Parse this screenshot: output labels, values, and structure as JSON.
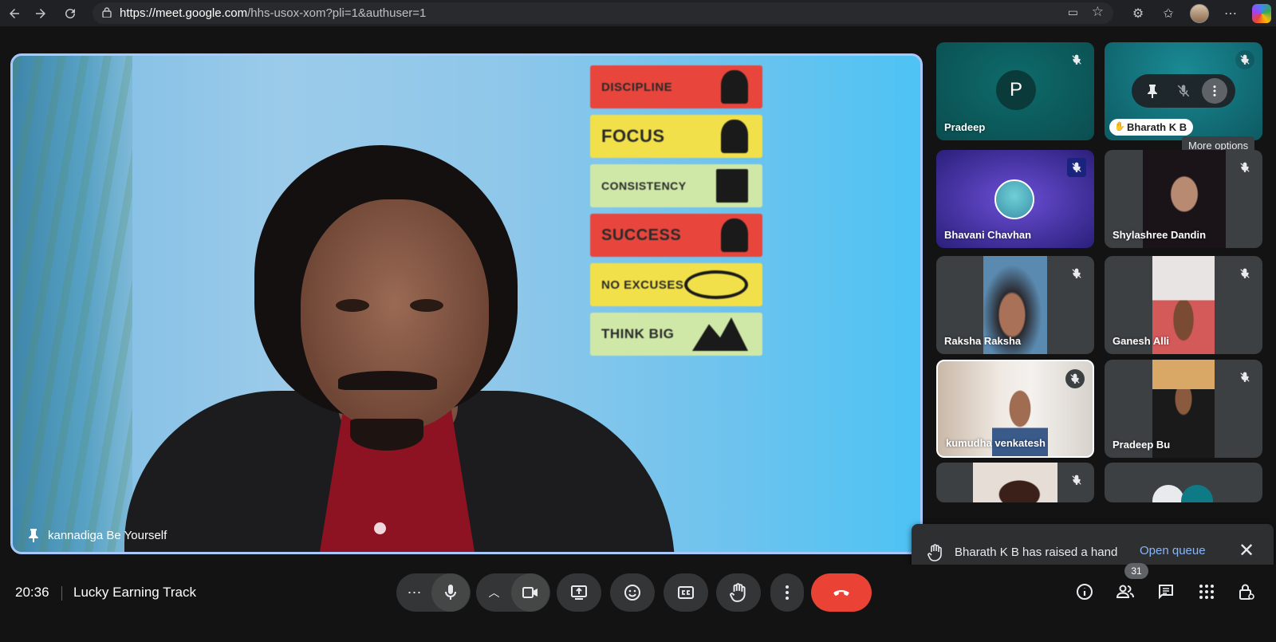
{
  "browser": {
    "url_host": "https://meet.google.com",
    "url_path": "/hhs-usox-xom?pli=1&authuser=1"
  },
  "main_video": {
    "participant_name": "kannadiga Be Yourself",
    "posters": [
      "DISCIPLINE",
      "FOCUS",
      "CONSISTENCY",
      "SUCCESS",
      "NO EXCUSES",
      "THINK BIG"
    ],
    "poster_colors": [
      "#e8453c",
      "#f2e04a",
      "#cfe8a8",
      "#e8453c",
      "#f2e04a",
      "#cfe8a8"
    ]
  },
  "participants": [
    {
      "name": "Pradeep",
      "avatar_letter": "P"
    },
    {
      "name": "Bharath K B",
      "chip": "Bharath K B"
    },
    {
      "name": "Bhavani Chavhan"
    },
    {
      "name": "Shylashree Dandin"
    },
    {
      "name": "Raksha Raksha"
    },
    {
      "name": "Ganesh Alli"
    },
    {
      "name": "kumudha venkatesh"
    },
    {
      "name": "Pradeep Bu"
    }
  ],
  "tooltip": "More options",
  "toast": {
    "message": "Bharath K B has raised a hand",
    "action": "Open queue"
  },
  "bottom": {
    "time": "20:36",
    "meeting_title": "Lucky Earning Track",
    "participant_count": "31"
  },
  "colors": {
    "accent_blue": "#a8c7fa",
    "leave_red": "#ea4335",
    "link_blue": "#8ab4f8"
  }
}
